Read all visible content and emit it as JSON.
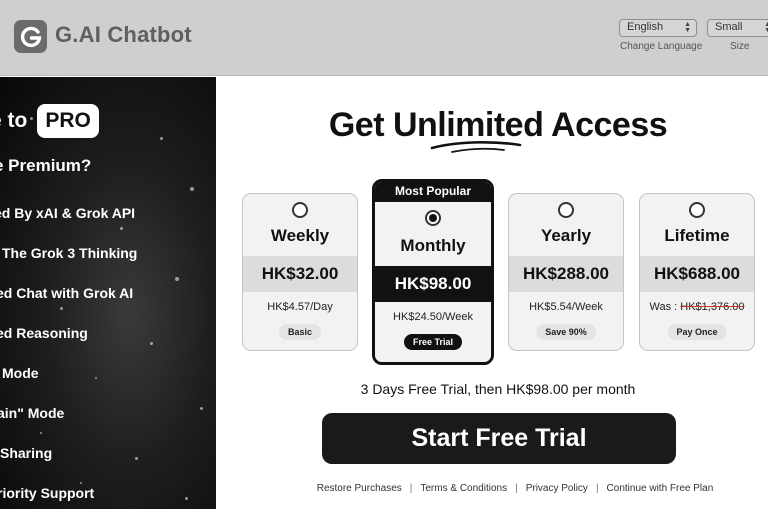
{
  "header": {
    "brand": "G.AI Chatbot",
    "logo_icon": "g-logo-icon",
    "language": {
      "value": "English",
      "caption": "Change Language"
    },
    "size": {
      "value": "Small",
      "caption": "Size"
    }
  },
  "left_panel": {
    "pro_prefix": "e to",
    "pro_badge": "PRO",
    "why_title": "e Premium?",
    "features": [
      "ed By xAI & Grok API",
      "The Grok 3 Thinking",
      "ed Chat with Grok AI",
      "ed Reasoning",
      "Mode",
      "ain\" Mode",
      "Sharing",
      "riority Support"
    ]
  },
  "main": {
    "heading": "Get Unlimited Access",
    "plans": [
      {
        "name": "Weekly",
        "price": "HK$32.00",
        "detail": "HK$4.57/Day",
        "tag": "Basic",
        "selected": false
      },
      {
        "name": "Monthly",
        "badge": "Most Popular",
        "price": "HK$98.00",
        "detail": "HK$24.50/Week",
        "tag": "Free Trial",
        "selected": true
      },
      {
        "name": "Yearly",
        "price": "HK$288.00",
        "detail": "HK$5.54/Week",
        "tag": "Save 90%",
        "selected": false
      },
      {
        "name": "Lifetime",
        "price": "HK$688.00",
        "was_label": "Was :",
        "was_price": "HK$1,376.00",
        "tag": "Pay Once",
        "selected": false
      }
    ],
    "trial_text": "3 Days Free Trial, then HK$98.00 per month",
    "cta": "Start Free Trial",
    "footer": [
      "Restore Purchases",
      "Terms & Conditions",
      "Privacy Policy",
      "Continue with Free Plan"
    ]
  },
  "colors": {
    "accent": "#111111",
    "header_bg": "#cfcfcf",
    "strike": "#c0392b"
  }
}
